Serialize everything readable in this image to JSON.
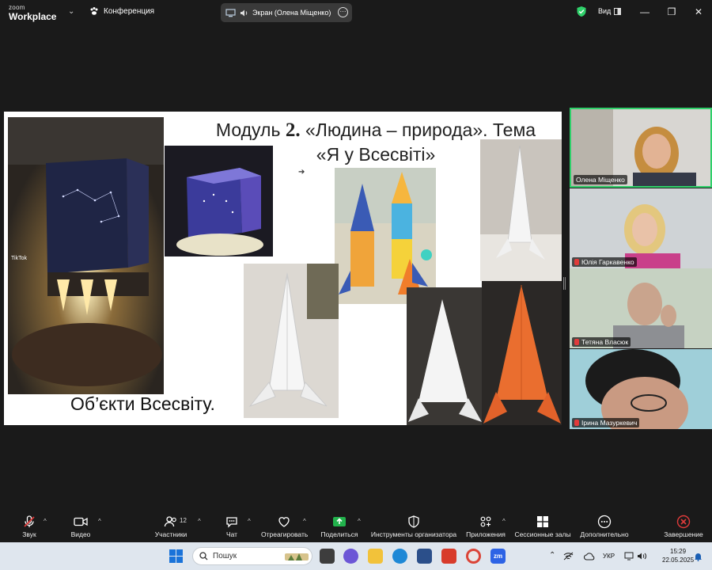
{
  "titlebar": {
    "brand_line1": "zoom",
    "brand_line2": "Workplace",
    "conference_label": "Конференция",
    "screen_label": "Экран (Олена Міщенко)",
    "view_label": "Вид"
  },
  "slide": {
    "title_prefix": "Модуль ",
    "title_number": "2.",
    "title_main": " «Людина – природа». Тема",
    "title_line2": "«Я у Всесвіті»",
    "caption": "Об’єкти Всесвіту.",
    "tiktok_label": "TikTok"
  },
  "participants": [
    {
      "name": "Олена Міщенко",
      "muted": false
    },
    {
      "name": "Юлія Гаркавенко",
      "muted": true
    },
    {
      "name": "Тетяна Власюк",
      "muted": true
    },
    {
      "name": "Ірина Мазуркевич",
      "muted": true
    }
  ],
  "toolbar": {
    "audio": "Звук",
    "video": "Видео",
    "participants": "Участники",
    "participants_count": "12",
    "chat": "Чат",
    "react": "Отреагировать",
    "share": "Поделиться",
    "host_tools": "Инструменты организатора",
    "apps": "Приложения",
    "rooms": "Сессионные залы",
    "more": "Дополнительно",
    "end": "Завершение"
  },
  "taskbar": {
    "search_placeholder": "Пошук",
    "language": "УКР",
    "time": "15:29",
    "date": "22.05.2025"
  },
  "colors": {
    "accent_green": "#2fd06a",
    "end_red": "#e03b3b",
    "share_green": "#22b24c"
  }
}
